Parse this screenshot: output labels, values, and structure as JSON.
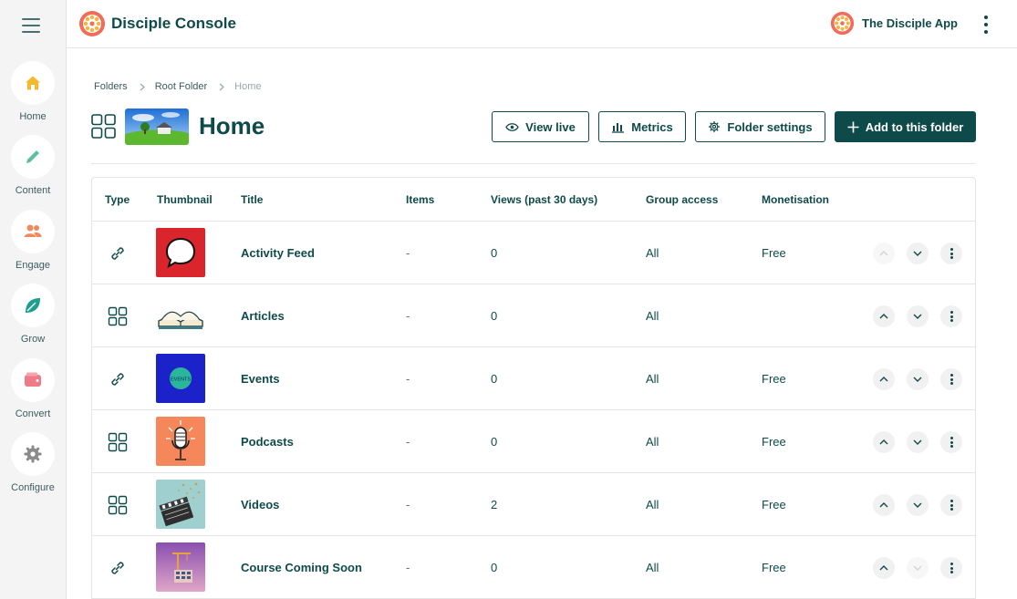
{
  "app": {
    "title": "Disciple Console",
    "app_name": "The Disciple App"
  },
  "sidebar": {
    "items": [
      {
        "label": "Home",
        "icon": "home-icon",
        "color": "#f5b82e"
      },
      {
        "label": "Content",
        "icon": "pencil-icon",
        "color": "#5fbf9f"
      },
      {
        "label": "Engage",
        "icon": "people-icon",
        "color": "#f08a5d"
      },
      {
        "label": "Grow",
        "icon": "leaf-icon",
        "color": "#1f9e8e"
      },
      {
        "label": "Convert",
        "icon": "wallet-icon",
        "color": "#ef7a88"
      },
      {
        "label": "Configure",
        "icon": "gear-icon",
        "color": "#8b8b8b"
      }
    ]
  },
  "breadcrumb": [
    "Folders",
    "Root Folder",
    "Home"
  ],
  "page": {
    "title": "Home",
    "actions": {
      "view_live": "View live",
      "metrics": "Metrics",
      "folder_settings": "Folder settings",
      "add": "Add to this folder"
    }
  },
  "table": {
    "columns": [
      "Type",
      "Thumbnail",
      "Title",
      "Items",
      "Views (past 30 days)",
      "Group access",
      "Monetisation"
    ],
    "rows": [
      {
        "type": "link",
        "title": "Activity Feed",
        "items": "-",
        "views": "0",
        "group_access": "All",
        "monetisation": "Free",
        "thumb": "speech-bubble",
        "thumb_text": "",
        "up_enabled": false,
        "down_enabled": true
      },
      {
        "type": "folder",
        "title": "Articles",
        "items": "-",
        "views": "0",
        "group_access": "All",
        "monetisation": "",
        "thumb": "open-book",
        "thumb_text": "",
        "up_enabled": true,
        "down_enabled": true
      },
      {
        "type": "link",
        "title": "Events",
        "items": "-",
        "views": "0",
        "group_access": "All",
        "monetisation": "Free",
        "thumb": "events-circle",
        "thumb_text": "EVENTS",
        "up_enabled": true,
        "down_enabled": true
      },
      {
        "type": "folder",
        "title": "Podcasts",
        "items": "-",
        "views": "0",
        "group_access": "All",
        "monetisation": "Free",
        "thumb": "microphone",
        "thumb_text": "",
        "up_enabled": true,
        "down_enabled": true
      },
      {
        "type": "folder",
        "title": "Videos",
        "items": "-",
        "views": "2",
        "group_access": "All",
        "monetisation": "Free",
        "thumb": "clapperboard",
        "thumb_text": "",
        "up_enabled": true,
        "down_enabled": true
      },
      {
        "type": "link",
        "title": "Course Coming Soon",
        "items": "-",
        "views": "0",
        "group_access": "All",
        "monetisation": "Free",
        "thumb": "construction",
        "thumb_text": "",
        "up_enabled": true,
        "down_enabled": false
      }
    ]
  },
  "colors": {
    "primary": "#0f4a4a",
    "logo": "#f26b5b"
  }
}
